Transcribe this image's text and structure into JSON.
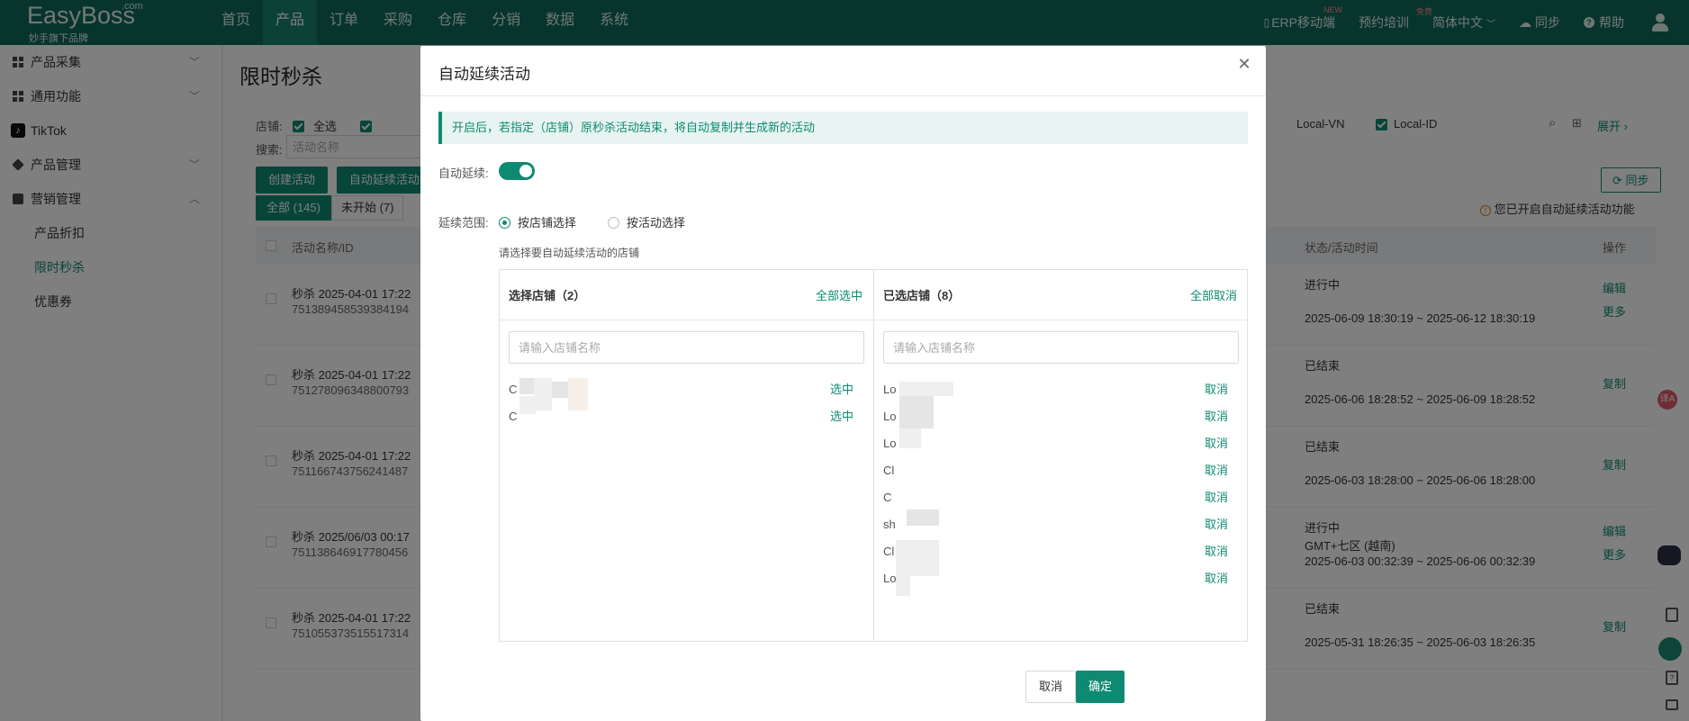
{
  "app": {
    "brand": "EasyBoss",
    "brand_suffix": ".com",
    "brand_sub": "妙手旗下品牌"
  },
  "nav": {
    "items": [
      "首页",
      "产品",
      "订单",
      "采购",
      "仓库",
      "分销",
      "数据",
      "系统"
    ],
    "active": "产品"
  },
  "topright": {
    "erp": "ERP移动端",
    "erp_badge": "NEW",
    "training": "预约培训",
    "training_badge": "免费",
    "lang": "简体中文",
    "sync": "同步",
    "help": "帮助"
  },
  "sidebar": {
    "groups": [
      {
        "label": "产品采集"
      },
      {
        "label": "通用功能"
      },
      {
        "label": "TikTok"
      },
      {
        "label": "产品管理"
      },
      {
        "label": "营销管理"
      }
    ],
    "subs": [
      "产品折扣",
      "限时秒杀",
      "优惠券"
    ],
    "active_sub": "限时秒杀"
  },
  "page": {
    "title": "限时秒杀",
    "store_label": "店铺:",
    "select_all": "全选",
    "local_vn": "Local-VN",
    "local_id": "Local-ID",
    "expand": "展开",
    "search_label": "搜索:",
    "search_placeholder": "活动名称",
    "create_btn": "创建活动",
    "auto_btn": "自动延续活动",
    "tab_all": "全部 (145)",
    "tab_pending": "未开始 (7)",
    "sync_btn": "同步",
    "auto_notice": "您已开启自动延续活动功能",
    "col_name": "活动名称/ID",
    "col_status": "状态/活动时间",
    "col_op": "操作",
    "rows": [
      {
        "name": "秒杀 2025-04-01 17:22",
        "id": "751389458539384194",
        "status": "进行中",
        "time": "2025-06-09 18:30:19 ~ 2025-06-12 18:30:19",
        "extra": "",
        "ops": [
          "编辑",
          "更多"
        ]
      },
      {
        "name": "秒杀 2025-04-01 17:22",
        "id": "751278096348800793",
        "status": "已结束",
        "time": "2025-06-06 18:28:52 ~ 2025-06-09 18:28:52",
        "extra": "",
        "ops": [
          "复制"
        ]
      },
      {
        "name": "秒杀 2025-04-01 17:22",
        "id": "751166743756241487",
        "status": "已结束",
        "time": "2025-06-03 18:28:00 ~ 2025-06-06 18:28:00",
        "extra": "",
        "ops": [
          "复制"
        ]
      },
      {
        "name": "秒杀 2025/06/03 00:17",
        "id": "751138646917780456",
        "status": "进行中",
        "time": "2025-06-03 00:32:39 ~ 2025-06-06 00:32:39",
        "extra": "GMT+七区 (越南)",
        "ops": [
          "编辑",
          "更多"
        ]
      },
      {
        "name": "秒杀 2025-04-01 17:22",
        "id": "751055373515517314",
        "status": "已结束",
        "time": "2025-05-31 18:26:35 ~ 2025-06-03 18:26:35",
        "extra": "",
        "ops": [
          "复制"
        ]
      }
    ]
  },
  "modal": {
    "title": "自动延续活动",
    "notice": "开启后，若指定（店铺）原秒杀活动结束，将自动复制并生成新的活动",
    "auto_label": "自动延续:",
    "auto_enabled": true,
    "scope_label": "延续范围:",
    "scope_options": [
      "按店铺选择",
      "按活动选择"
    ],
    "scope_selected": "按店铺选择",
    "hint": "请选择要自动延续活动的店铺",
    "left_panel": {
      "title": "选择店铺（2）",
      "action": "全部选中",
      "placeholder": "请输入店铺名称",
      "stores": [
        {
          "name": "C",
          "action": "选中"
        },
        {
          "name": "C",
          "action": "选中"
        }
      ]
    },
    "right_panel": {
      "title": "已选店铺（8）",
      "action": "全部取消",
      "placeholder": "请输入店铺名称",
      "stores": [
        {
          "name": "Lo",
          "action": "取消"
        },
        {
          "name": "Lo",
          "action": "取消"
        },
        {
          "name": "Lo",
          "action": "取消"
        },
        {
          "name": "Cl",
          "action": "取消"
        },
        {
          "name": "C",
          "action": "取消"
        },
        {
          "name": "sh",
          "action": "取消"
        },
        {
          "name": "Cl",
          "action": "取消"
        },
        {
          "name": "Lo",
          "action": "取消"
        }
      ]
    },
    "cancel": "取消",
    "confirm": "确定"
  },
  "colors": {
    "primary": "#0e8a73",
    "topbar": "#0e6b5a"
  }
}
